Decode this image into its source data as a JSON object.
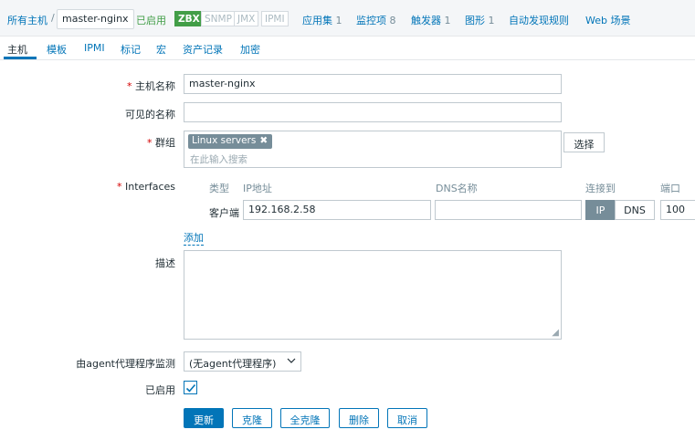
{
  "breadcrumb": {
    "all_hosts": "所有主机",
    "separator": "/",
    "current_host": "master-nginx",
    "status": "已启用",
    "availability": [
      "ZBX",
      "SNMP",
      "JMX",
      "IPMI"
    ],
    "links": [
      {
        "label": "应用集",
        "count": "1"
      },
      {
        "label": "监控项",
        "count": "8"
      },
      {
        "label": "触发器",
        "count": "1"
      },
      {
        "label": "图形",
        "count": "1"
      },
      {
        "label": "自动发现规则",
        "count": ""
      },
      {
        "label": "Web 场景",
        "count": ""
      }
    ]
  },
  "tabs": [
    "主机",
    "模板",
    "IPMI",
    "标记",
    "宏",
    "资产记录",
    "加密"
  ],
  "form": {
    "host_name": {
      "required": "*",
      "label": "主机名称",
      "value": "master-nginx"
    },
    "visible_name": {
      "label": "可见的名称",
      "value": ""
    },
    "groups": {
      "required": "*",
      "label": "群组",
      "tag": "Linux servers",
      "placeholder": "在此输入搜索",
      "select_button": "选择"
    },
    "interfaces": {
      "required": "*",
      "label": "Interfaces",
      "columns": {
        "type": "类型",
        "ip": "IP地址",
        "dns": "DNS名称",
        "connect_to": "连接到",
        "port": "端口"
      },
      "row": {
        "type": "客户端",
        "ip": "192.168.2.58",
        "dns": "",
        "connect_ip": "IP",
        "connect_dns": "DNS",
        "port": "100"
      },
      "add": "添加"
    },
    "description": {
      "label": "描述",
      "value": ""
    },
    "proxy": {
      "label": "由agent代理程序监测",
      "value": "(无agent代理程序)"
    },
    "enabled": {
      "label": "已启用",
      "checked": true
    }
  },
  "buttons": {
    "update": "更新",
    "clone": "克隆",
    "full_clone": "全克隆",
    "delete": "删除",
    "cancel": "取消"
  },
  "colors": {
    "accent": "#0275b8",
    "enabled_green": "#429e47",
    "required_red": "#d40000",
    "muted": "#768d99"
  }
}
